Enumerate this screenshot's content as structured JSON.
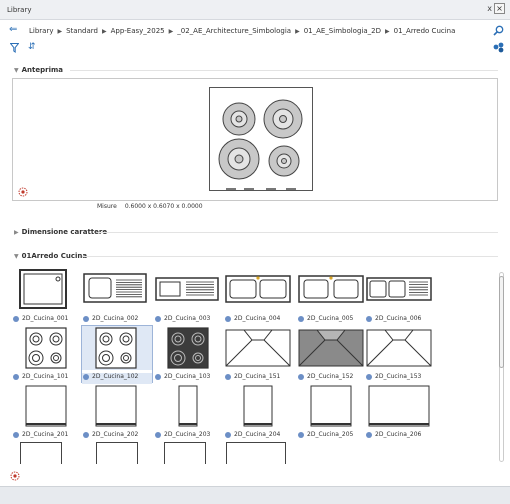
{
  "window": {
    "title": "Library",
    "pin_glyph": "ⅹ",
    "close_glyph": "×"
  },
  "breadcrumb": {
    "items": [
      "Library",
      "Standard",
      "App-Easy_2025",
      "_02_AE_Architecture_Simbologia",
      "01_AE_Simbologia_2D",
      "01_Arredo Cucina"
    ],
    "back_icon": "back-arrow-icon",
    "search_icon": "search-icon"
  },
  "toolbar": {
    "filter_icon": "filter-icon",
    "sort_icon": "sort-icon",
    "sort_glyph": "⇵",
    "settings_icon": "dots-icon"
  },
  "preview": {
    "header": "Anteprima",
    "measure_label": "Misure",
    "measure_value": "0.6000 x 0.6070 x 0.0000"
  },
  "font_section": {
    "header": "Dimensione carattere"
  },
  "catalog": {
    "header": "01Arredo Cucina",
    "items": [
      {
        "label": "2D_Cucina_001",
        "kind": "sink-single"
      },
      {
        "label": "2D_Cucina_002",
        "kind": "sink-drainer"
      },
      {
        "label": "2D_Cucina_003",
        "kind": "sink-long"
      },
      {
        "label": "2D_Cucina_004",
        "kind": "sink-double"
      },
      {
        "label": "2D_Cucina_005",
        "kind": "sink-double-small"
      },
      {
        "label": "2D_Cucina_006",
        "kind": "sink-double-drainer"
      },
      {
        "label": "2D_Cucina_101",
        "kind": "hob-white"
      },
      {
        "label": "2D_Cucina_102",
        "kind": "hob-white",
        "selected": true
      },
      {
        "label": "2D_Cucina_103",
        "kind": "hob-dark"
      },
      {
        "label": "2D_Cucina_151",
        "kind": "hood-white"
      },
      {
        "label": "2D_Cucina_152",
        "kind": "hood-grey"
      },
      {
        "label": "2D_Cucina_153",
        "kind": "hood-white"
      },
      {
        "label": "2D_Cucina_201",
        "kind": "box-square"
      },
      {
        "label": "2D_Cucina_202",
        "kind": "box-square"
      },
      {
        "label": "2D_Cucina_203",
        "kind": "box-narrow"
      },
      {
        "label": "2D_Cucina_204",
        "kind": "box-mid"
      },
      {
        "label": "2D_Cucina_205",
        "kind": "box-square"
      },
      {
        "label": "2D_Cucina_206",
        "kind": "box-wide"
      }
    ]
  },
  "colors": {
    "accent": "#2b6fb6",
    "selection": "#dfe8f5",
    "bullet": "#6c8fc6",
    "dark_hob": "#3c3c3c",
    "hood_grey": "#8a8a8a"
  }
}
